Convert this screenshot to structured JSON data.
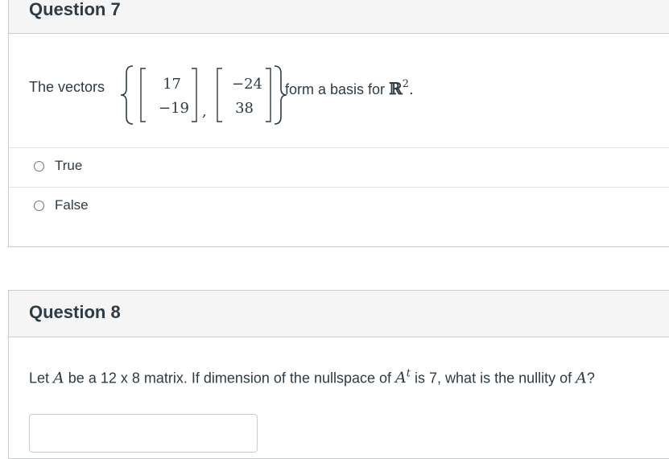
{
  "question7": {
    "title": "Question 7",
    "prompt_prefix": "The vectors",
    "vector1": [
      "17",
      "−19"
    ],
    "vector2": [
      "−24",
      "38"
    ],
    "comma": ",",
    "prompt_suffix": "form a basis for",
    "set_symbol": "ℝ",
    "superscript": "2",
    "period": ".",
    "answers": [
      {
        "label": "True"
      },
      {
        "label": "False"
      }
    ]
  },
  "question8": {
    "title": "Question 8",
    "p1": "Let",
    "A": "A",
    "p2": "be a 12 x 8 matrix. If dimension of the nullspace of",
    "At_base": "A",
    "At_sup": "t",
    "p3": "is 7, what is the nullity of",
    "A_end": "A",
    "q": "?",
    "answer_value": ""
  }
}
